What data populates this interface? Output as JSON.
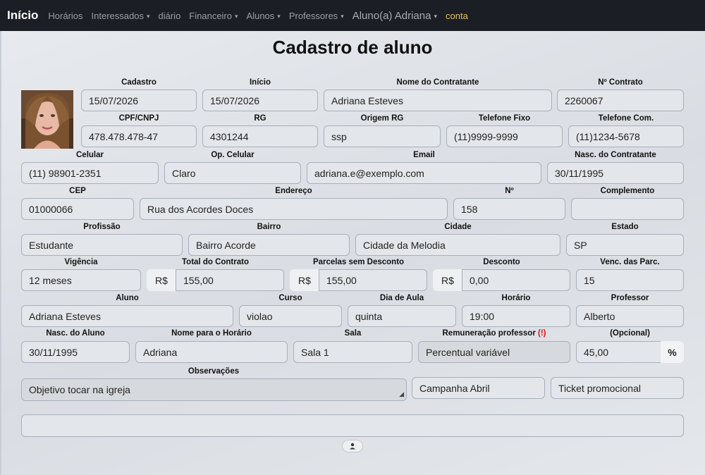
{
  "nav": {
    "brand": "Início",
    "items": [
      "Horários",
      "Interessados",
      "diário",
      "Financeiro",
      "Alunos",
      "Professores"
    ],
    "user": "Aluno(a) Adriana",
    "account": "conta",
    "caret": "▾"
  },
  "page": {
    "title": "Cadastro de aluno"
  },
  "labels": {
    "cadastro": "Cadastro",
    "inicio": "Início",
    "nome_contratante": "Nome do Contratante",
    "n_contrato": "Nº Contrato",
    "cpf": "CPF/CNPJ",
    "rg": "RG",
    "origem_rg": "Origem RG",
    "tel_fixo": "Telefone Fixo",
    "tel_com": "Telefone Com.",
    "celular": "Celular",
    "op_celular": "Op. Celular",
    "email": "Email",
    "nasc_contratante": "Nasc. do Contratante",
    "cep": "CEP",
    "endereco": "Endereço",
    "numero": "Nº",
    "complemento": "Complemento",
    "profissao": "Profissão",
    "bairro": "Bairro",
    "cidade": "Cidade",
    "estado": "Estado",
    "vigencia": "Vigência",
    "total_contrato": "Total do Contrato",
    "parcelas_sem_desconto": "Parcelas sem Desconto",
    "desconto": "Desconto",
    "venc_parc": "Venc. das Parc.",
    "aluno": "Aluno",
    "curso": "Curso",
    "dia_aula": "Dia de Aula",
    "horario": "Horário",
    "professor": "Professor",
    "nasc_aluno": "Nasc. do Aluno",
    "nome_horario": "Nome para o Horário",
    "sala": "Sala",
    "remuneracao": "Remuneração professor",
    "remuneracao_flag": "(!)",
    "opcional": "(Opcional)",
    "observacoes": "Observações"
  },
  "values": {
    "cadastro": "15/07/2026",
    "inicio": "15/07/2026",
    "nome_contratante": "Adriana Esteves",
    "n_contrato": "2260067",
    "cpf": "478.478.478-47",
    "rg": "4301244",
    "origem_rg": "ssp",
    "tel_fixo": "(11)9999-9999",
    "tel_com": "(11)1234-5678",
    "celular": "(11) 98901-2351",
    "op_celular": "Claro",
    "email": "adriana.e@exemplo.com",
    "nasc_contratante": "30/11/1995",
    "cep": "01000066",
    "endereco": "Rua dos Acordes Doces",
    "numero": "158",
    "complemento": "",
    "profissao": "Estudante",
    "bairro": "Bairro Acorde",
    "cidade": "Cidade da Melodia",
    "estado": "SP",
    "vigencia": "12 meses",
    "total_contrato": "155,00",
    "parcelas_sem_desconto": "155,00",
    "desconto": "0,00",
    "venc_parc": "15",
    "aluno": "Adriana Esteves",
    "curso": "violao",
    "dia_aula": "quinta",
    "horario": "19:00",
    "professor": "Alberto",
    "nasc_aluno": "30/11/1995",
    "nome_horario": "Adriana",
    "sala": "Sala 1",
    "remuneracao": "Percentual variável",
    "percentual": "45,00",
    "observacoes": "Objetivo tocar na igreja",
    "campanha": "Campanha Abril",
    "ticket": "Ticket promocional",
    "extra": ""
  },
  "addons": {
    "currency": "R$",
    "percent": "%"
  },
  "icons": {
    "user": "user-icon",
    "resize": "resize-grip-icon"
  }
}
